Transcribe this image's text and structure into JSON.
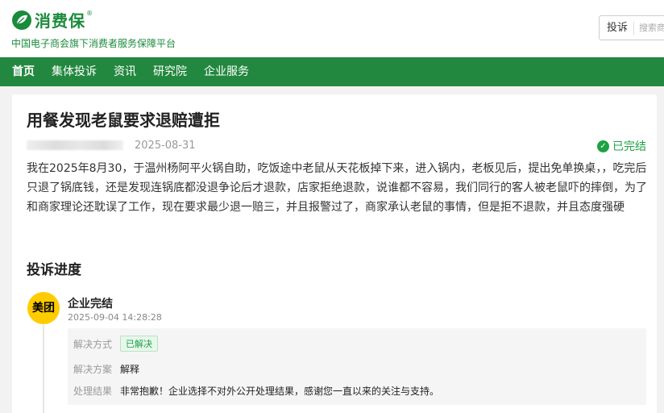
{
  "header": {
    "logo_text": "消费保",
    "logo_mark": "®",
    "tagline": "中国电子商会旗下消费者服务保障平台",
    "search": {
      "type_label": "投诉",
      "placeholder": "搜索商家"
    }
  },
  "nav": {
    "items": [
      {
        "label": "首页",
        "active": true
      },
      {
        "label": "集体投诉",
        "active": false
      },
      {
        "label": "资讯",
        "active": false
      },
      {
        "label": "研究院",
        "active": false
      },
      {
        "label": "企业服务",
        "active": false
      }
    ]
  },
  "complaint": {
    "title": "用餐发现老鼠要求退赔遭拒",
    "date": "2025-08-31",
    "status": "已完结",
    "content": "我在2025年8月30，于温州杨阿平火锅自助，吃饭途中老鼠从天花板掉下来，进入锅内，老板见后，提出免单换桌，，吃完后只退了锅底钱，还是发现连锅底都没退争论后才退款，店家拒绝退款，说谁都不容易，我们同行的客人被老鼠吓的摔倒，为了和商家理论还耽误了工作，现在要求最少退一赔三，并且报警过了，商家承认老鼠的事情，但是拒不退款，并且态度强硬"
  },
  "progress": {
    "section_title": "投诉进度",
    "steps": [
      {
        "avatar_text": "美团",
        "name": "企业完结",
        "time": "2025-09-04 14:28:28",
        "resolution_method_label": "解决方式",
        "resolution_method_value": "已解决",
        "resolution_plan_label": "解决方案",
        "resolution_plan_value": "解释",
        "result_label": "处理结果",
        "result_value": "非常抱歉！企业选择不对外公开处理结果，感谢您一直以来的关注与支持。"
      }
    ]
  },
  "colors": {
    "brand_green": "#23883f",
    "status_green": "#1ea144",
    "avatar_yellow": "#ffcc00"
  }
}
